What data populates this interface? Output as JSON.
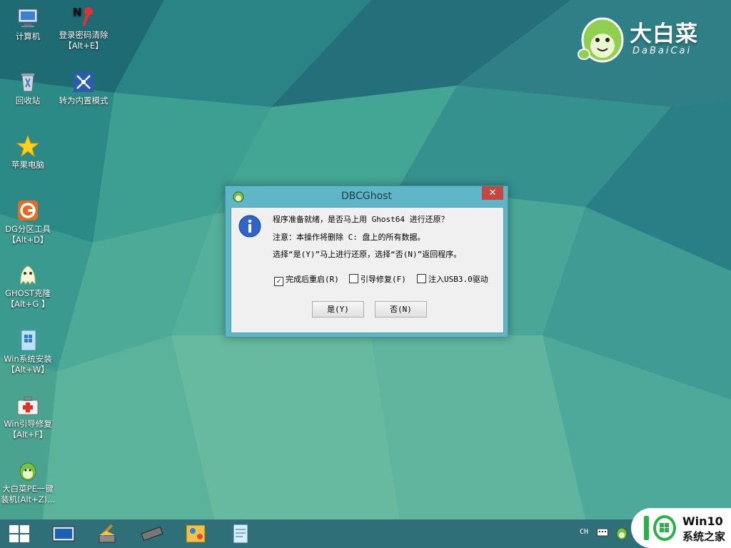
{
  "desktop_icons": [
    {
      "id": "computer",
      "line1": "计算机",
      "line2": ""
    },
    {
      "id": "login-pwd",
      "line1": "登录密码清除",
      "line2": "【Alt+E】"
    },
    {
      "id": "recycle",
      "line1": "回收站",
      "line2": ""
    },
    {
      "id": "builtin",
      "line1": "转为内置模式",
      "line2": ""
    },
    {
      "id": "apple",
      "line1": "苹果电脑",
      "line2": ""
    },
    {
      "id": "dg",
      "line1": "DG分区工具",
      "line2": "【Alt+D】"
    },
    {
      "id": "ghost",
      "line1": "GHOST克隆",
      "line2": "【Alt+G 】"
    },
    {
      "id": "winsetup",
      "line1": "Win系统安装",
      "line2": "【Alt+W】"
    },
    {
      "id": "bootfix",
      "line1": "Win引导修复",
      "line2": "【Alt+F】"
    },
    {
      "id": "onekey",
      "line1": "大白菜PE一键",
      "line2": "装机(Alt+Z)..."
    }
  ],
  "logo": {
    "title": "大白菜",
    "subtitle": "DaBaiCai"
  },
  "dialog": {
    "title": "DBCGhost",
    "close": "✕",
    "line1": "程序准备就绪，是否马上用 Ghost64 进行还原？",
    "line2": "注意：本操作将删除 C: 盘上的所有数据。",
    "line3": "选择“是(Y)”马上进行还原，选择“否(N)”返回程序。",
    "checkboxes": [
      {
        "label": "完成后重启(R)",
        "checked": true,
        "mark": "✓"
      },
      {
        "label": "引导修复(F)",
        "checked": false,
        "mark": ""
      },
      {
        "label": "注入USB3.0驱动",
        "checked": false,
        "mark": ""
      }
    ],
    "yes": "是(Y)",
    "no": "否(N)"
  },
  "taskbar": {
    "lang": "CH"
  },
  "watermark": {
    "line1": "Win10",
    "line2": "系统之家"
  },
  "colors": {
    "accent": "#5fb6c6",
    "close": "#c7463f",
    "taskbar": "#2f6f78"
  }
}
